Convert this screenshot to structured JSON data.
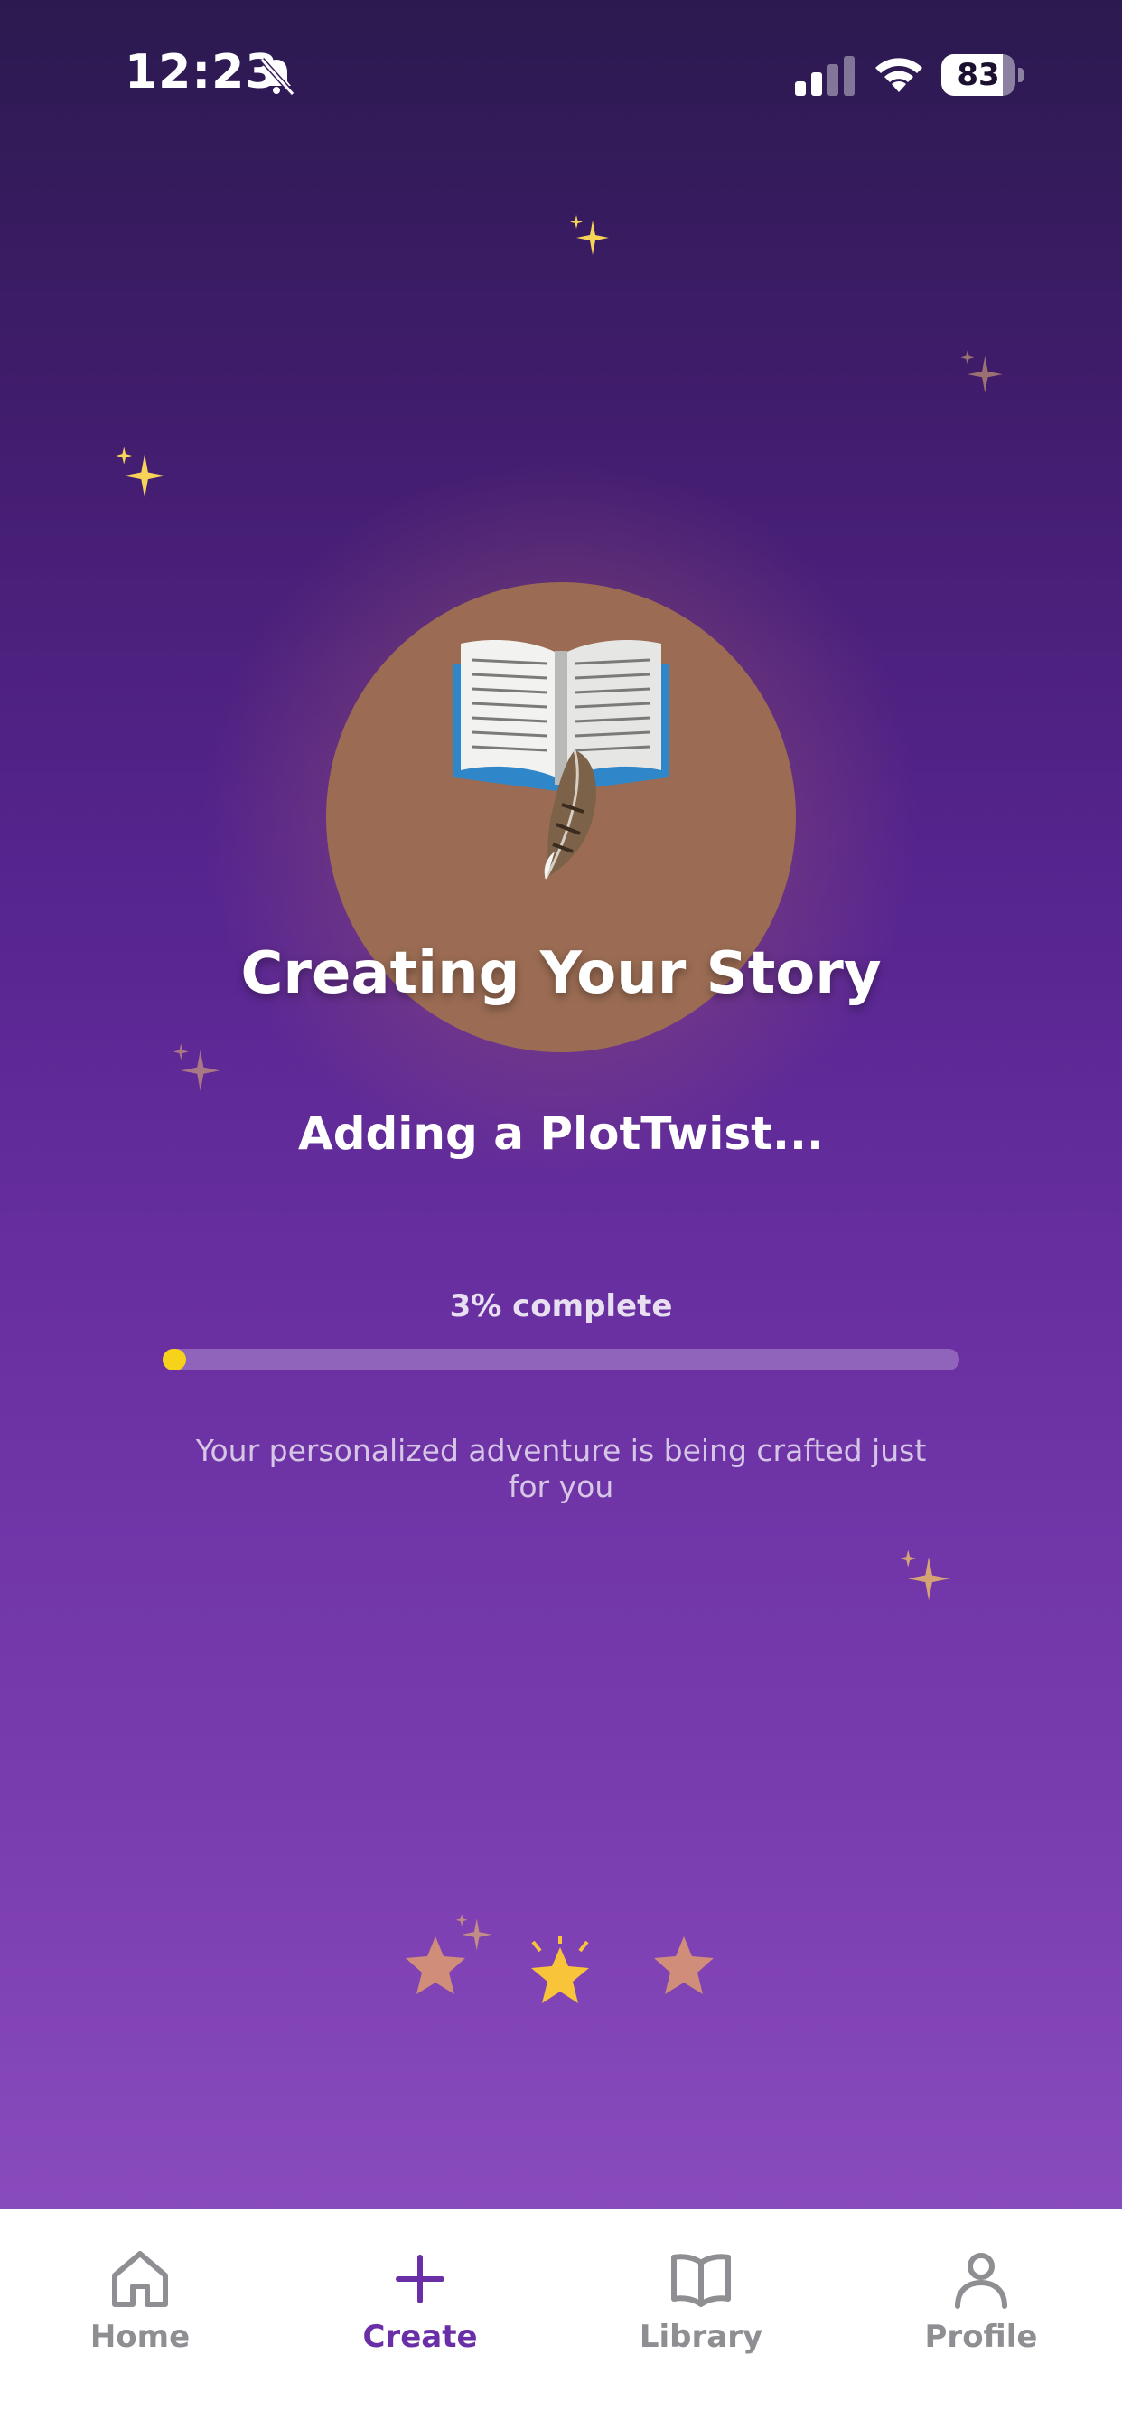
{
  "status_bar": {
    "time": "12:23",
    "battery": "83",
    "battery_level": 0.83
  },
  "loading": {
    "title": "Creating Your Story",
    "status": "Adding a PlotTwist...",
    "progress_label": "3% complete",
    "progress": 0.03,
    "message": "Your personalized adventure is being crafted just for you",
    "center_icon": "book-and-feather-icon"
  },
  "colors": {
    "accent": "#6a2fa6",
    "progress_fill": "#f6d21a",
    "orb": "#9b6c53",
    "tab_inactive": "#8e8e93"
  },
  "tabs": [
    {
      "label": "Home",
      "icon": "home-icon",
      "active": false
    },
    {
      "label": "Create",
      "icon": "plus-icon",
      "active": true
    },
    {
      "label": "Library",
      "icon": "book-icon",
      "active": false
    },
    {
      "label": "Profile",
      "icon": "person-icon",
      "active": false
    }
  ]
}
